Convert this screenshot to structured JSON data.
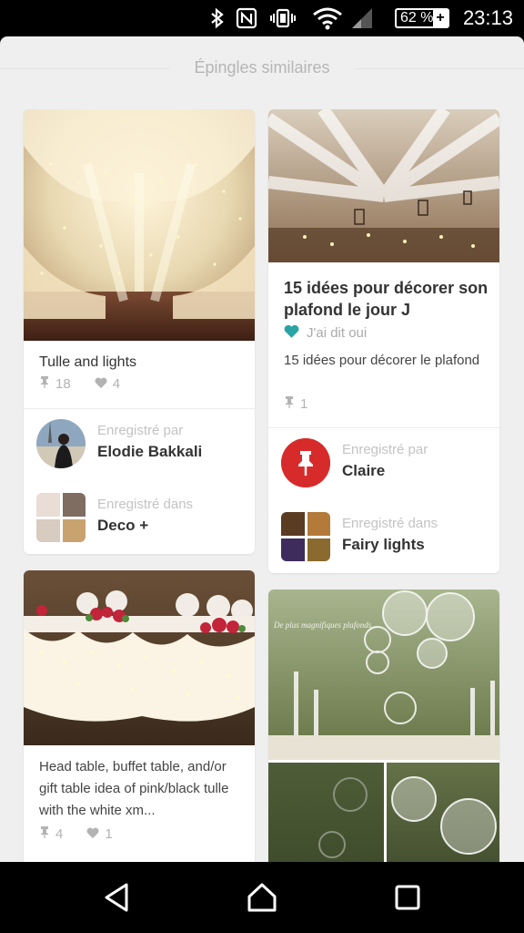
{
  "status_bar": {
    "icons": [
      "bluetooth-icon",
      "nfc-icon",
      "vibrate-icon",
      "wifi-icon",
      "signal-icon"
    ],
    "battery": "62 %",
    "time": "23:13"
  },
  "sheet": {
    "title": "Épingles similaires"
  },
  "pins": [
    {
      "title": "Tulle and lights",
      "repins": "18",
      "likes": "4",
      "saved_by_label": "Enregistré par",
      "saved_by_name": "Elodie Bakkali",
      "saved_in_label": "Enregistré dans",
      "board_name": "Deco +"
    },
    {
      "title": "15 idées pour décorer son plafond le jour J",
      "source": "J'ai dit oui",
      "description": "15 idées pour décorer le plafond",
      "repins": "1",
      "saved_by_label": "Enregistré par",
      "saved_by_name": "Claire",
      "saved_in_label": "Enregistré dans",
      "board_name": "Fairy lights"
    },
    {
      "description": "Head table, buffet table, and/or gift table idea of pink/black tulle with the white xm...",
      "repins": "4",
      "likes": "1"
    },
    {
      "overlay_text": "De plus magnifiques plafonds..."
    }
  ],
  "colors": {
    "accent_red": "#d72b2b",
    "heart_teal": "#2aa3a3"
  },
  "nav": {
    "icons": [
      "back-icon",
      "home-icon",
      "recents-icon"
    ]
  }
}
